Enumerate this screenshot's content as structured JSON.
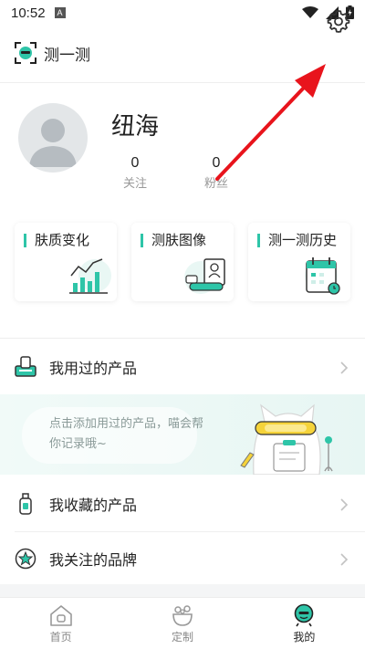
{
  "status_bar": {
    "time": "10:52",
    "badge": "A"
  },
  "header": {
    "title": "测一测",
    "logo_icon": "face-scan-icon",
    "settings_icon": "gear-icon"
  },
  "profile": {
    "nickname": "纽海",
    "following": {
      "count": "0",
      "label": "关注"
    },
    "followers": {
      "count": "0",
      "label": "粉丝"
    }
  },
  "cards": [
    {
      "title": "肤质变化",
      "icon": "bar-chart-illustration"
    },
    {
      "title": "测肤图像",
      "icon": "profile-image-illustration"
    },
    {
      "title": "测一测历史",
      "icon": "calendar-illustration"
    }
  ],
  "list": {
    "used_products": "我用过的产品",
    "favorite_products": "我收藏的产品",
    "followed_brands": "我关注的品牌"
  },
  "banner": {
    "text": "点击添加用过的产品，喵会帮你记录哦~"
  },
  "bottom_nav": [
    {
      "label": "首页",
      "icon": "home-icon",
      "active": false
    },
    {
      "label": "定制",
      "icon": "custom-icon",
      "active": false
    },
    {
      "label": "我的",
      "icon": "profile-face-icon",
      "active": true
    }
  ],
  "colors": {
    "accent": "#2ec5a8",
    "annotation": "#e8141c",
    "text": "#222222",
    "muted": "#999999"
  }
}
